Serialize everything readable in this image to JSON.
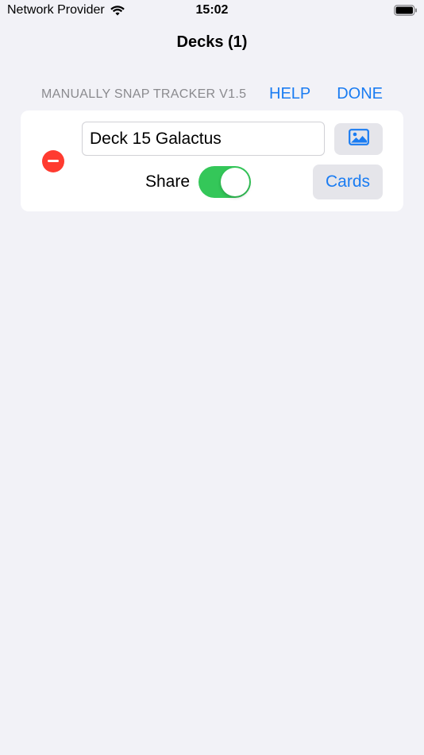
{
  "status_bar": {
    "carrier": "Network Provider",
    "time": "15:02",
    "wifi_icon": "wifi-icon",
    "battery_icon": "battery-icon"
  },
  "nav": {
    "title": "Decks (1)"
  },
  "section_header": {
    "version": "MANUALLY SNAP TRACKER V1.5",
    "help_label": "HELP",
    "done_label": "DONE"
  },
  "deck": {
    "name": "Deck 15 Galactus",
    "share_label": "Share",
    "share_enabled": true,
    "cards_label": "Cards",
    "image_icon": "photo-icon",
    "delete_icon": "minus-circle-icon"
  },
  "colors": {
    "accent": "#1a7cf2",
    "background": "#f2f2f7",
    "delete": "#ff3b30",
    "toggle_on": "#34c759",
    "secondary_text": "#8a8a8e",
    "button_bg": "#e5e5ea"
  }
}
